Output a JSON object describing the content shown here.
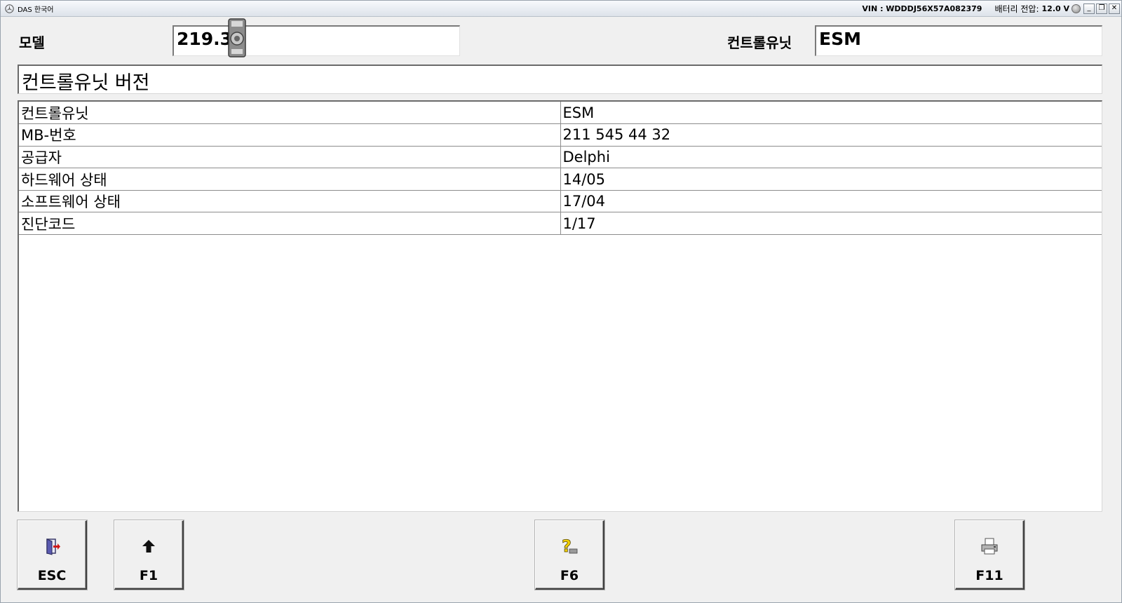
{
  "titlebar": {
    "app_title": "DAS 한국어",
    "vin": "VIN : WDDDJ56X57A082379",
    "battery_label": "배터리 전압:",
    "battery_value": "12.0 V",
    "minimize": "_",
    "restore": "❐",
    "close": "✕"
  },
  "header": {
    "model_label": "모델",
    "model_value": "219.3",
    "control_unit_label": "컨트롤유닛",
    "control_unit_value": "ESM"
  },
  "section": {
    "title": "컨트롤유닛 버전"
  },
  "table": {
    "rows": [
      {
        "name": "컨트롤유닛",
        "value": "ESM"
      },
      {
        "name": "MB-번호",
        "value": "211 545 44 32"
      },
      {
        "name": "공급자",
        "value": "Delphi"
      },
      {
        "name": "하드웨어 상태",
        "value": "14/05"
      },
      {
        "name": "소프트웨어 상태",
        "value": "17/04"
      },
      {
        "name": "진단코드",
        "value": "1/17"
      }
    ]
  },
  "buttons": {
    "esc": {
      "label": "ESC",
      "icon": "exit-door-icon"
    },
    "f1": {
      "label": "F1",
      "icon": "arrow-up-icon"
    },
    "f6": {
      "label": "F6",
      "icon": "help-question-icon"
    },
    "f11": {
      "label": "F11",
      "icon": "printer-icon"
    }
  },
  "colors": {
    "window_bg": "#f0f0f0",
    "field_bg": "#ffffff",
    "help_icon": "#f2d000",
    "exit_icon_arrow": "#d01818"
  }
}
